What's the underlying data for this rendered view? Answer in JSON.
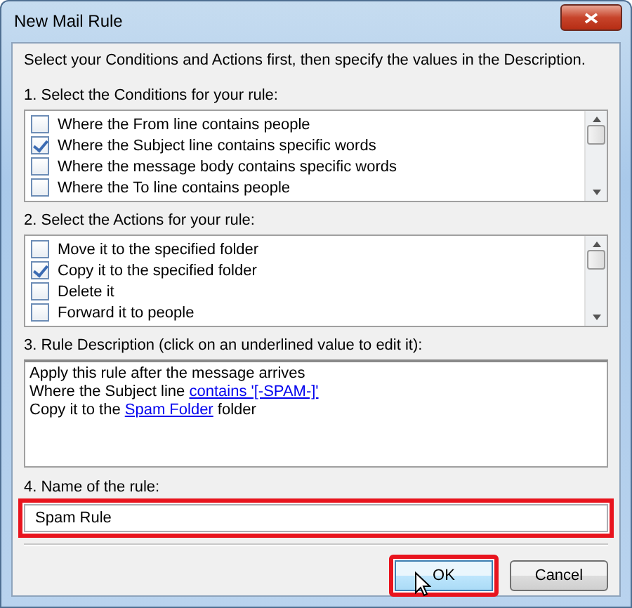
{
  "window": {
    "title": "New Mail Rule"
  },
  "intro": "Select your Conditions and Actions first, then specify the values in the Description.",
  "conditions": {
    "label": "1. Select the Conditions for your rule:",
    "items": [
      {
        "label": "Where the From line contains people",
        "checked": false
      },
      {
        "label": "Where the Subject line contains specific words",
        "checked": true
      },
      {
        "label": "Where the message body contains specific words",
        "checked": false
      },
      {
        "label": "Where the To line contains people",
        "checked": false
      }
    ]
  },
  "actions": {
    "label": "2. Select the Actions for your rule:",
    "items": [
      {
        "label": "Move it to the specified folder",
        "checked": false
      },
      {
        "label": "Copy it to the specified folder",
        "checked": true
      },
      {
        "label": "Delete it",
        "checked": false
      },
      {
        "label": "Forward it to people",
        "checked": false
      }
    ]
  },
  "description": {
    "label": "3. Rule Description (click on an underlined value to edit it):",
    "lines": [
      [
        {
          "text": "Apply this rule after the message arrives",
          "kind": "plain"
        }
      ],
      [
        {
          "text": "Where the Subject line ",
          "kind": "plain"
        },
        {
          "text": "contains '[-SPAM-]'",
          "kind": "link"
        }
      ],
      [
        {
          "text": "Copy it to the ",
          "kind": "plain"
        },
        {
          "text": "Spam Folder",
          "kind": "link"
        },
        {
          "text": " folder",
          "kind": "plain"
        }
      ]
    ]
  },
  "name_field": {
    "label": "4. Name of the rule:",
    "value": "Spam Rule",
    "highlighted": true
  },
  "buttons": [
    {
      "label": "OK",
      "kind": "default",
      "highlighted": true
    },
    {
      "label": "Cancel",
      "kind": "normal",
      "highlighted": false
    }
  ]
}
